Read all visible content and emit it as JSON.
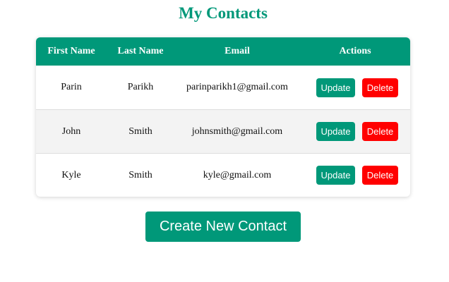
{
  "page": {
    "title": "My Contacts",
    "accent_color": "#009879",
    "danger_color": "#ff0000"
  },
  "table": {
    "headers": {
      "first_name": "First Name",
      "last_name": "Last Name",
      "email": "Email",
      "actions": "Actions"
    },
    "rows": [
      {
        "first_name": "Parin",
        "last_name": "Parikh",
        "email": "parinparikh1@gmail.com",
        "update_label": "Update",
        "delete_label": "Delete"
      },
      {
        "first_name": "John",
        "last_name": "Smith",
        "email": "johnsmith@gmail.com",
        "update_label": "Update",
        "delete_label": "Delete"
      },
      {
        "first_name": "Kyle",
        "last_name": "Smith",
        "email": "kyle@gmail.com",
        "update_label": "Update",
        "delete_label": "Delete"
      }
    ]
  },
  "create_button": {
    "label": "Create New Contact"
  }
}
